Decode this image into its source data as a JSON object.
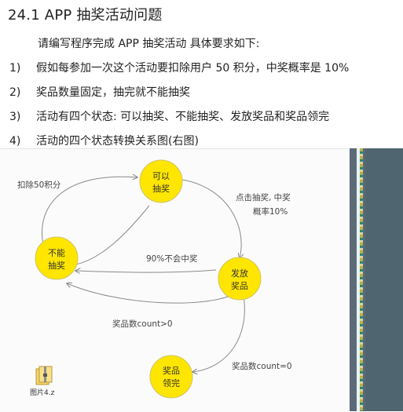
{
  "document": {
    "title": "24.1 APP 抽奖活动问题",
    "intro": "请编写程序完成 APP 抽奖活动 具体要求如下:",
    "requirements": [
      {
        "num": "1)",
        "text": "假如每参加一次这个活动要扣除用户 50 积分，中奖概率是 10%"
      },
      {
        "num": "2)",
        "text": "奖品数量固定，抽完就不能抽奖"
      },
      {
        "num": "3)",
        "text": "活动有四个状态: 可以抽奖、不能抽奖、发放奖品和奖品领完"
      },
      {
        "num": "4)",
        "text": "活动的四个状态转换关系图(右图)"
      }
    ]
  },
  "diagram": {
    "states": [
      {
        "id": "can_draw",
        "line1": "可以",
        "line2": "抽奖"
      },
      {
        "id": "cannot_draw",
        "line1": "不能",
        "line2": "抽奖"
      },
      {
        "id": "dispense",
        "line1": "发放",
        "line2": "奖品"
      },
      {
        "id": "exhausted",
        "line1": "奖品",
        "line2": "领完"
      }
    ],
    "transitions": {
      "deduct": "扣除50积分",
      "click_draw_line1": "点击抽奖, 中奖",
      "click_draw_line2": "概率10%",
      "no_win": "90%不会中奖",
      "count_positive": "奖品数count>0",
      "count_zero": "奖品数count=0"
    },
    "state_color": "#ffe600",
    "state_stroke": "#cfc36a"
  },
  "attachment": {
    "filename": "图片4.z"
  }
}
